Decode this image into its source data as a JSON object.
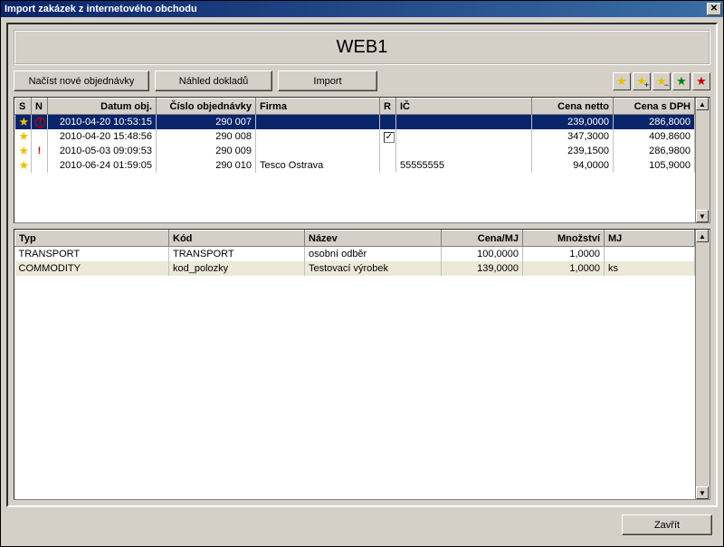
{
  "window": {
    "title": "Import zakázek z internetového obchodu"
  },
  "shop": {
    "name": "WEB1"
  },
  "toolbar": {
    "load": "Načíst nové objednávky",
    "preview": "Náhled dokladů",
    "import": "Import"
  },
  "order_grid": {
    "columns": {
      "s": "S",
      "n": "N",
      "date": "Datum obj.",
      "number": "Číslo objednávky",
      "firm": "Firma",
      "r": "R",
      "ico": "IČ",
      "netto": "Cena netto",
      "dph": "Cena s DPH"
    },
    "rows": [
      {
        "s": "star",
        "n": "circle-excl",
        "date": "2010-04-20 10:53:15",
        "number": "290 007",
        "firm": "",
        "r": "",
        "ico": "",
        "netto": "239,0000",
        "dph": "286,8000",
        "selected": true
      },
      {
        "s": "star",
        "n": "",
        "date": "2010-04-20 15:48:56",
        "number": "290 008",
        "firm": "",
        "r": "check",
        "ico": "",
        "netto": "347,3000",
        "dph": "409,8600"
      },
      {
        "s": "star",
        "n": "excl",
        "date": "2010-05-03 09:09:53",
        "number": "290 009",
        "firm": "",
        "r": "",
        "ico": "",
        "netto": "239,1500",
        "dph": "286,9800"
      },
      {
        "s": "star",
        "n": "",
        "date": "2010-06-24 01:59:05",
        "number": "290 010",
        "firm": "Tesco Ostrava",
        "r": "",
        "ico": "55555555",
        "netto": "94,0000",
        "dph": "105,9000"
      }
    ]
  },
  "item_grid": {
    "columns": {
      "typ": "Typ",
      "kod": "Kód",
      "nazev": "Název",
      "cena": "Cena/MJ",
      "mnozstvi": "Množství",
      "mj": "MJ"
    },
    "rows": [
      {
        "typ": "TRANSPORT",
        "kod": "TRANSPORT",
        "nazev": "osobní odběr",
        "cena": "100,0000",
        "mnozstvi": "1,0000",
        "mj": ""
      },
      {
        "typ": "COMMODITY",
        "kod": "kod_polozky",
        "nazev": "Testovací výrobek",
        "cena": "139,0000",
        "mnozstvi": "1,0000",
        "mj": "ks",
        "alt": true
      }
    ]
  },
  "footer": {
    "close": "Zavřít"
  },
  "icons": {
    "star": "★",
    "check": "✓",
    "excl": "!",
    "plus": "+",
    "minus": "−",
    "up": "▲",
    "down": "▼",
    "close": "✕"
  }
}
